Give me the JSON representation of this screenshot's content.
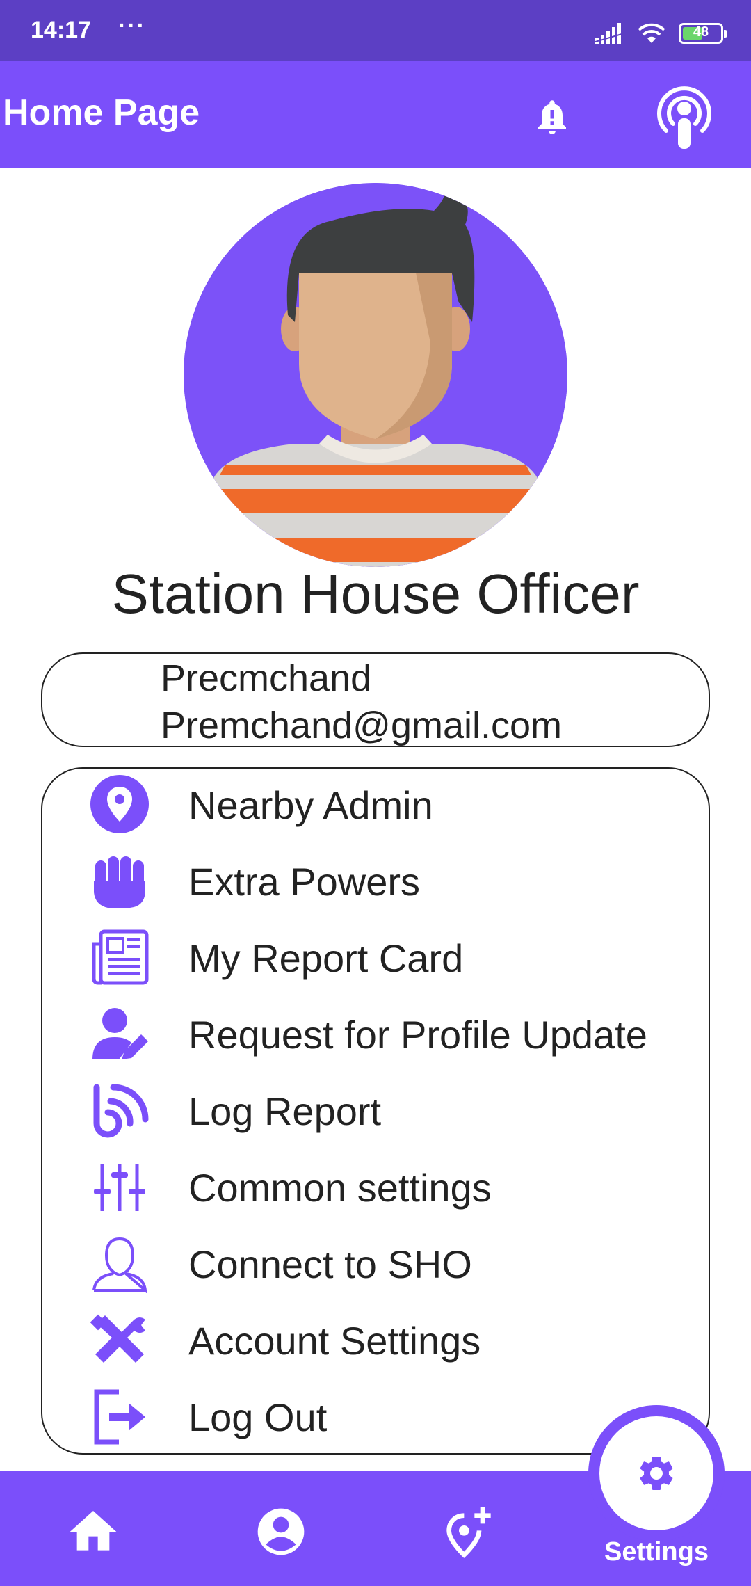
{
  "status_bar": {
    "time": "14:17",
    "overflow": "···",
    "battery": "48"
  },
  "appbar": {
    "title": "Home Page"
  },
  "colors": {
    "primary": "#7b4ffa",
    "status": "#5c3fc4",
    "avatar_bg": "#7c52f8"
  },
  "profile": {
    "role": "Station House Officer",
    "name": "Precmchand",
    "email": "Premchand@gmail.com"
  },
  "menu": {
    "items": [
      {
        "label": "Nearby Admin",
        "icon": "location-pin-icon"
      },
      {
        "label": "Extra Powers",
        "icon": "fist-icon"
      },
      {
        "label": "My Report Card",
        "icon": "newspaper-icon"
      },
      {
        "label": "Request for Profile Update",
        "icon": "user-edit-icon"
      },
      {
        "label": "Log Report",
        "icon": "rss-feed-icon"
      },
      {
        "label": "Common settings",
        "icon": "sliders-icon"
      },
      {
        "label": "Connect to SHO",
        "icon": "person-outline-icon"
      },
      {
        "label": "Account Settings",
        "icon": "tools-icon"
      },
      {
        "label": "Log Out",
        "icon": "logout-icon"
      }
    ]
  },
  "bottom_nav": {
    "items": [
      {
        "icon": "home-icon"
      },
      {
        "icon": "account-circle-icon"
      },
      {
        "icon": "add-location-icon"
      },
      {
        "icon": "gear-icon",
        "label": "Settings",
        "active": true
      }
    ]
  }
}
